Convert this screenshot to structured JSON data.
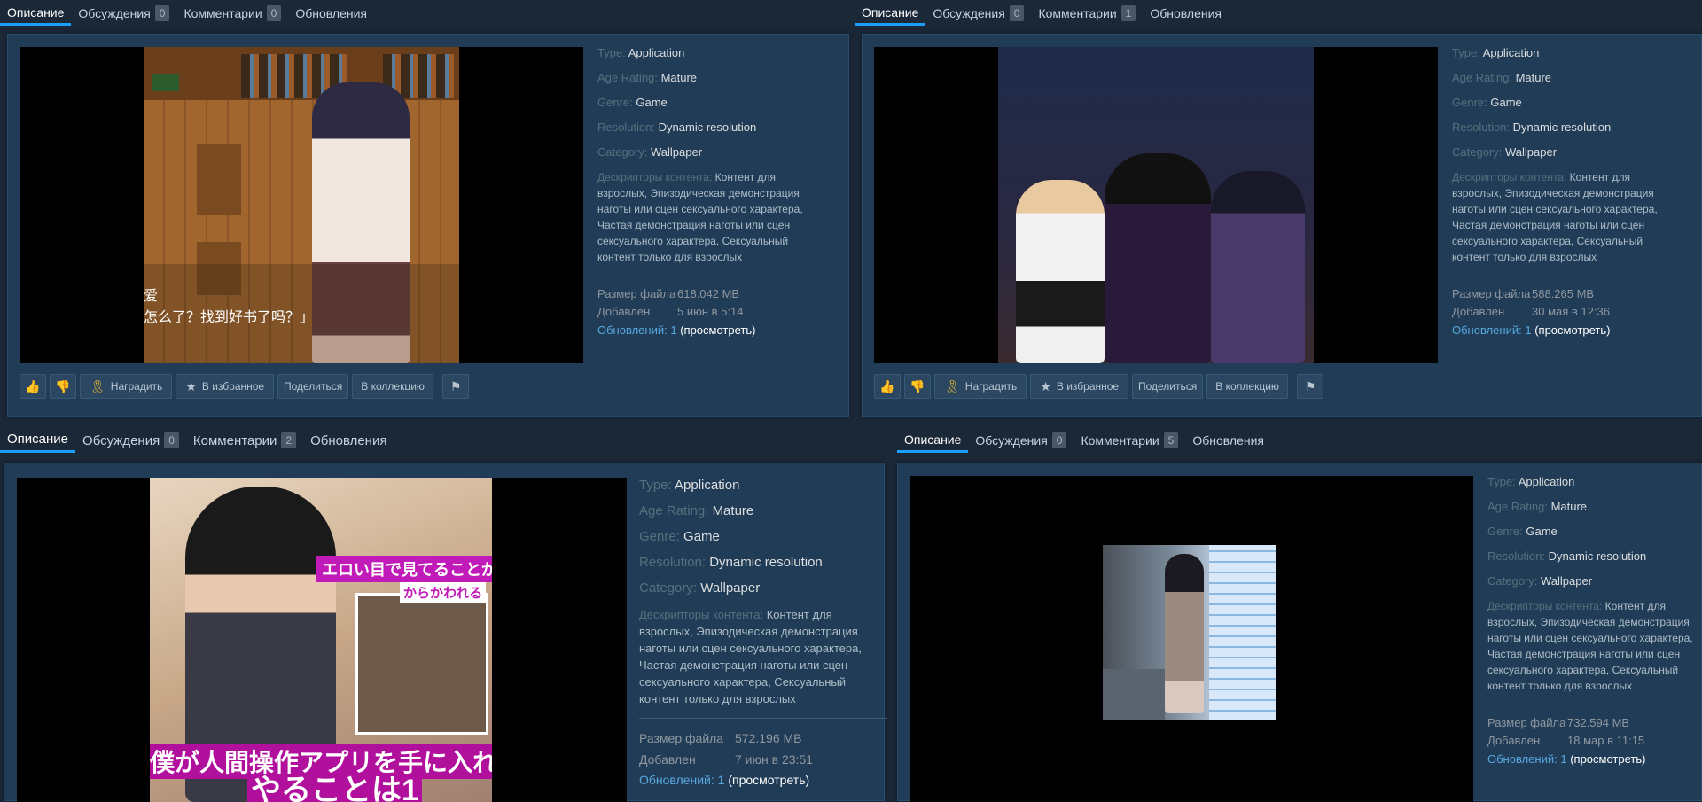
{
  "tab_labels": {
    "description": "Описание",
    "discussions": "Обсуждения",
    "comments": "Комментарии",
    "updates": "Обновления"
  },
  "field_labels": {
    "type": "Type:",
    "age": "Age Rating:",
    "genre": "Genre:",
    "resolution": "Resolution:",
    "category": "Category:",
    "descriptors": "Дескрипторы контента:",
    "file_size": "Размер файла",
    "added": "Добавлен",
    "updates": "Обновлений:",
    "view": "(просмотреть)"
  },
  "buttons": {
    "award": "Наградить",
    "favorite": "В избранное",
    "share": "Поделиться",
    "collection": "В коллекцию"
  },
  "icons": {
    "like": "thumbs-up-icon",
    "dislike": "thumbs-down-icon",
    "award": "award-ribbon-icon",
    "favorite": "star-icon",
    "report": "flag-icon"
  },
  "colors": {
    "page_bg": "#1b2838",
    "card_bg": "#213c56",
    "accent": "#1a9fff",
    "link": "#57a9e0"
  },
  "items": [
    {
      "discussions_count": "0",
      "comments_count": "0",
      "type": "Application",
      "age": "Mature",
      "genre": "Game",
      "resolution": "Dynamic resolution",
      "category": "Wallpaper",
      "descriptors": "Контент для взрослых, Эпизодическая демонстрация наготы или сцен сексуального характера, Частая демонстрация наготы или сцен сексуального характера, Сексуальный контент только для взрослых",
      "desc_lines": [
        "Контент для",
        "взрослых, Эпизодическая демонстрация",
        "наготы или сцен сексуального характера,",
        "Частая демонстрация наготы или сцен",
        "сексуального характера, Сексуальный",
        "контент только для взрослых"
      ],
      "file_size": "618.042 MB",
      "added": "5 июн в 5:14",
      "updates_count": "1",
      "subtitle_1": "爱",
      "subtitle_2": "怎么了？找到好书了吗？」"
    },
    {
      "discussions_count": "0",
      "comments_count": "1",
      "type": "Application",
      "age": "Mature",
      "genre": "Game",
      "resolution": "Dynamic resolution",
      "category": "Wallpaper",
      "descriptors": "Контент для взрослых, Эпизодическая демонстрация наготы или сцен сексуального характера, Частая демонстрация наготы или сцен сексуального характера, Сексуальный контент только для взрослых",
      "desc_lines": [
        "Контент для",
        "взрослых, Эпизодическая демонстрация",
        "наготы или сцен сексуального характера,",
        "Частая демонстрация наготы или сцен",
        "сексуального характера, Сексуальный",
        "контент только для взрослых"
      ],
      "file_size": "588.265 MB",
      "added": "30 мая в 12:36",
      "updates_count": "1"
    },
    {
      "discussions_count": "0",
      "comments_count": "2",
      "type": "Application",
      "age": "Mature",
      "genre": "Game",
      "resolution": "Dynamic resolution",
      "category": "Wallpaper",
      "descriptors": "Контент для взрослых, Эпизодическая демонстрация наготы или сцен сексуального характера, Частая демонстрация наготы или сцен сексуального характера, Сексуальный контент только для взрослых",
      "desc_lines": [
        "Контент для",
        "взрослых, Эпизодическая демонстрация",
        "наготы или сцен сексуального характера,",
        "Частая демонстрация наготы или сцен",
        "сексуального характера, Сексуальный",
        "контент только для взрослых"
      ],
      "file_size": "572.196 MB",
      "added": "7 июн в 23:51",
      "updates_count": "1",
      "art_text_1": "エロい目で見てることが",
      "art_text_2": "からかわれる",
      "art_text_3": "僕が人間操作アプリを手に入れ",
      "art_text_4": "やることは1"
    },
    {
      "discussions_count": "0",
      "comments_count": "5",
      "type": "Application",
      "age": "Mature",
      "genre": "Game",
      "resolution": "Dynamic resolution",
      "category": "Wallpaper",
      "descriptors": "Контент для взрослых, Эпизодическая демонстрация наготы или сцен сексуального характера, Частая демонстрация наготы или сцен сексуального характера, Сексуальный контент только для взрослых",
      "desc_lines": [
        "Контент для",
        "взрослых, Эпизодическая демонстрация",
        "наготы или сцен сексуального характера,",
        "Частая демонстрация наготы или сцен",
        "сексуального характера, Сексуальный",
        "контент только для взрослых"
      ],
      "file_size": "732.594 MB",
      "added": "18 мар в 11:15",
      "updates_count": "1"
    }
  ]
}
